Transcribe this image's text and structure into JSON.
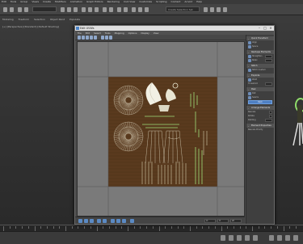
{
  "host": {
    "menu": [
      "Edit",
      "Tools",
      "Group",
      "Views",
      "Create",
      "Modifiers",
      "Animation",
      "Graph Editors",
      "Rendering",
      "Civil View",
      "Customize",
      "Scripting",
      "Content",
      "Arnold",
      "Help"
    ],
    "toolbar_field": "Create Selection Set",
    "viewport_label": "[+] [Perspective] [Standard] [Default Shading]",
    "subbar": [
      "Modeling",
      "Freeform",
      "Selection",
      "Object Paint",
      "Populate"
    ]
  },
  "uv_editor": {
    "title": "Edit UVWs",
    "menu": [
      "File",
      "Edit",
      "Select",
      "Tools",
      "Mapping",
      "Options",
      "Display",
      "View"
    ],
    "bottom": {
      "u_label": "U:",
      "v_label": "V:",
      "w_label": "W:",
      "grid_value": "0.0",
      "zoom_label": "All IDs"
    },
    "panel": {
      "sections": [
        {
          "title": "Quick Transform",
          "rows": [
            "Align",
            "Space"
          ]
        },
        {
          "title": "Reshape Elements",
          "rows": [
            "Straighten",
            "Relax"
          ]
        },
        {
          "title": "Stitch",
          "rows": [
            "Stitch Custom"
          ]
        },
        {
          "title": "Explode",
          "rows": [
            "Weld",
            "Threshold"
          ]
        },
        {
          "title": "Peel",
          "rows": [
            "Pelt",
            "Seams"
          ]
        },
        {
          "title": "Arrange Elements",
          "rows": [
            "Rescale",
            "Rotate",
            "Padding"
          ]
        },
        {
          "title": "Element Properties",
          "rows": [
            "Rescale Priority"
          ]
        }
      ],
      "active_button": "Pack"
    }
  },
  "colors": {
    "texture": "#5a3a1e",
    "uv_lines": "#e8e8c8",
    "uv_green": "#8fdc6a",
    "accent": "#4e7fc2"
  }
}
